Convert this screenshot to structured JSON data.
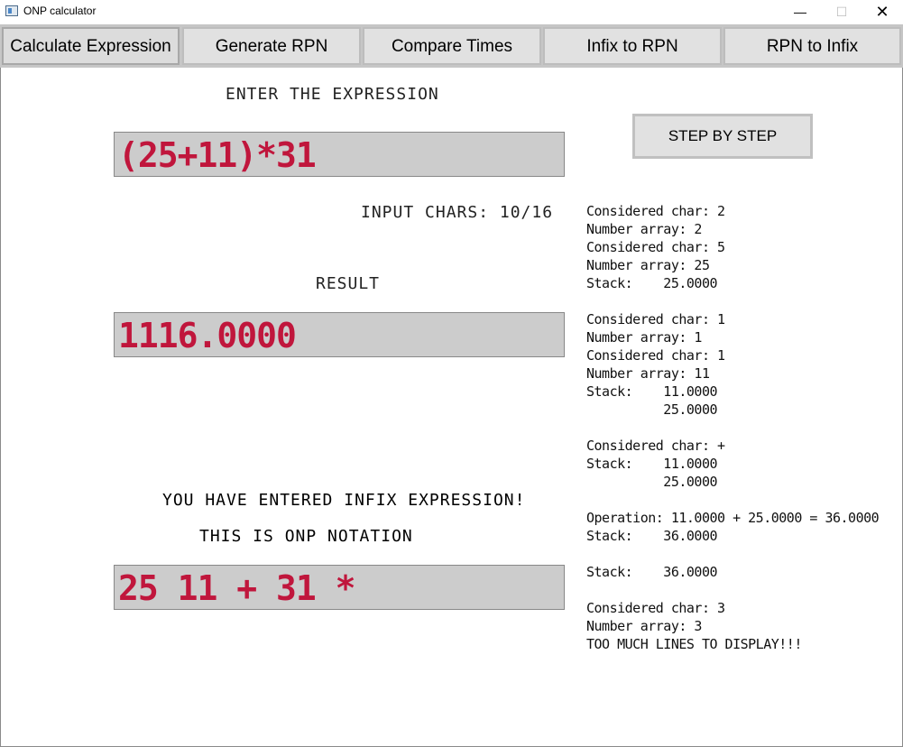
{
  "window": {
    "title": "ONP calculator",
    "min_glyph": "—",
    "max_glyph": "☐",
    "close_glyph": "✕"
  },
  "tabs": [
    {
      "label": "Calculate Expression",
      "active": true
    },
    {
      "label": "Generate RPN",
      "active": false
    },
    {
      "label": "Compare Times",
      "active": false
    },
    {
      "label": "Infix to RPN",
      "active": false
    },
    {
      "label": "RPN to Infix",
      "active": false
    }
  ],
  "main": {
    "enter_label": "ENTER THE EXPRESSION",
    "expression": "(25+11)*31",
    "input_chars": "INPUT CHARS: 10/16",
    "result_label": "RESULT",
    "result": "1116.0000",
    "infix_message": "YOU HAVE ENTERED INFIX EXPRESSION!",
    "onp_label": "THIS IS ONP NOTATION",
    "onp": "25 11 + 31 *",
    "step_button": "STEP BY STEP"
  },
  "log": [
    "Considered char: 2",
    "Number array: 2",
    "Considered char: 5",
    "Number array: 25",
    "Stack:    25.0000",
    "",
    "Considered char: 1",
    "Number array: 1",
    "Considered char: 1",
    "Number array: 11",
    "Stack:    11.0000",
    "          25.0000",
    "",
    "Considered char: +",
    "Stack:    11.0000",
    "          25.0000",
    "",
    "Operation: 11.0000 + 25.0000 = 36.0000",
    "Stack:    36.0000",
    "",
    "Stack:    36.0000",
    "",
    "Considered char: 3",
    "Number array: 3",
    "TOO MUCH LINES TO DISPLAY!!!"
  ],
  "colors": {
    "display_text": "#c0163c",
    "display_bg": "#cccccc"
  }
}
